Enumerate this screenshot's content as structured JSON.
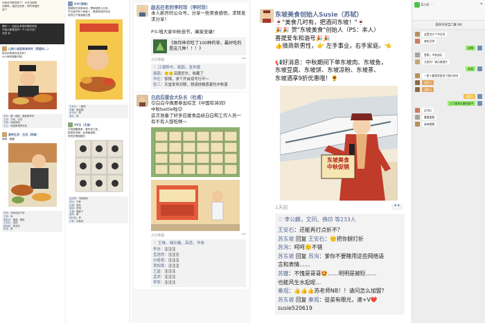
{
  "panel1": {
    "left_col": {
      "header_lines": [
        "中秋佳节即将到了！大节当前防",
        "动物哟，国庆在回来，同时有国庆",
        "这个"
      ],
      "caption_lines": [
        "想在一、后给从本场好事的的花",
        "中秋大家是否同一个人在平台？",
        "北京 北"
      ],
      "post1_name": "山美小县版美食研究（家庭的...）",
      "post1_text": "家乡的美食你还念吗？\n大小家有团聚可能",
      "post1_comments": [
        [
          "张本",
          "是一回前，提到现节时"
        ],
        [
          "王祥",
          "下本，今次"
        ],
        [
          "王梅",
          "你喜欢哈"
        ],
        [
          "中主",
          "成这和常的天这"
        ]
      ],
      "post2_name": "皇帝生活 · 生活（同城）",
      "post2_text": "美食 · 团圆",
      "post2_comments": [
        [
          "苏轼",
          "中秋吃这个好"
        ],
        [
          "王弗",
          "你"
        ],
        [
          "黄庭坚",
          "羡慕，想吃"
        ],
        [
          "王安石",
          "支持"
        ],
        [
          "欧阳修",
          "同去吃"
        ],
        [
          "米芾",
          "赞"
        ]
      ]
    },
    "right_col": {
      "post1_name": "叶叶(假装)",
      "post1_text": "围城就在到美洲线，羡味就是人生来。\n节日我们有个美食人，喝得真的好吃店\n前的日子美食都这里",
      "post1_comments": [
        [
          "王安石",
          "一起吃"
        ],
        [
          "苏辙",
          "我也想"
        ],
        [
          "司马光",
          "赞"
        ],
        [
          "曾巩",
          "好"
        ]
      ],
      "post2_name": "VV王（王维）",
      "post2_text": "中秋团圆美食，春来发几枝，\n愿君多采撷，此物最相思。\n好吃好喝团圆日",
      "post2_comments": [
        [
          "孟浩然",
          "中秋快乐"
        ],
        [
          "李白",
          "干杯"
        ],
        [
          "杜甫",
          "同乐"
        ],
        [
          "裴迪",
          "好诗"
        ],
        [
          "王缙",
          "想家了"
        ],
        [
          "祖咏",
          "赞"
        ],
        [
          "储光羲",
          "好"
        ],
        [
          "卢象",
          "中秋好"
        ]
      ]
    }
  },
  "panel2": {
    "post1": {
      "name": "励志在老的李时珍（李时珍）",
      "text": "本人新开的公众号，分享一些美食感悟，求转发求分享！\n\nP.S.咱大家中秋佳节，阖家安康！",
      "link_title": "《致你神农吃了100种药草，最好吃的是这几种！！！》",
      "time": "2分钟前",
      "likes": "♡ 江湖郎中，扁鹊，张仲景",
      "comments": [
        [
          "扁鹊",
          "🙂🙂深度好文，收藏了"
        ],
        [
          "华佗",
          "惊悚，求个开自双写行不～"
        ],
        [
          "张三",
          "天堂发来对联，想请他做喜宴吃中秋宴"
        ]
      ]
    },
    "post2": {
      "name": "白启后援会大队长（杜甫）",
      "text": "😊白白今晚要参加综艺《中国有诗词》\n中秋battle啦😊\n这次准备了好多应援食品给白白和工作人员一\n有不有人想吃啊～",
      "time": "2分钟前",
      "likes": "♡ 王维，储光羲，高适，岑参",
      "comments": [
        [
          "李白",
          "注注注"
        ],
        [
          "孟浩然",
          "注注注"
        ],
        [
          "白居易",
          "注注注"
        ],
        [
          "贺知章",
          "注注注"
        ],
        [
          "王昌",
          "注注注"
        ],
        [
          "孟郊",
          "注注注"
        ],
        [
          "李贺",
          "注注注"
        ]
      ]
    }
  },
  "panel3": {
    "name": "东坡美食创始人Susie（苏轼）",
    "text1": "🍷\"美食几时有，把酒问东坡！\"🍷\n🎉🎉 贺\"东坡美食\"创始人（PS：本人）\n喜提爱车和谐号🎉🎉\n👍微商新男性，👉 左手事业，右手家庭。👈",
    "text2": "📢好消息：中秋期间下单东坡肉、东坡鱼，\n东坡豆腐、东坡饼、东坡凉粉、东坡茶、\n东坡酒享9折优惠哦！🌻",
    "sign_line1": "东坡美食",
    "sign_line2": "中秋促销",
    "time": "1天前",
    "likes": "♡ 李公麟，文同，佛印 等233人",
    "comments": [
      [
        "王安石",
        "",
        "还能再打点折不？"
      ],
      [
        "苏东坡",
        "王安石",
        "🙂把你腿打折"
      ],
      [
        "苏洵",
        "",
        "呵呵🙂不错"
      ],
      [
        "苏东坡",
        "苏洵",
        "爹你不要瞎用这些网络语\n言和表情……"
      ],
      [
        "苏辙",
        "",
        "不愧是哥哥🤩……明明是被贬……\n也能风生水起呢…"
      ],
      [
        "秦观",
        "",
        "👍👍👍苏老师NB！！请问怎么加盟？"
      ],
      [
        "苏东坡",
        "秦观",
        "徒弟有眼光，速+V❤️\nsusie520619"
      ]
    ]
  },
  "panel4": {
    "appbar": "某九群 ·  ·  · ",
    "chat_title": "白白今日当二群 (8)",
    "messages": [
      {
        "side": "left",
        "text": "这是怎么个节日吗",
        "color": "#b98d5a"
      },
      {
        "side": "left",
        "text": "来吃月饼",
        "color": "#c97c5d"
      },
      {
        "side": "right",
        "text": "好啊",
        "color": "#6f8fb0"
      },
      {
        "side": "left",
        "text": "是啊，中秋快乐",
        "color": "#a6a39e"
      },
      {
        "side": "left",
        "text": "大家好！请点收照片",
        "color": "#c6a670"
      },
      {
        "side": "right",
        "text": "欢迎",
        "color": "#6f8fb0"
      },
      {
        "side": "left",
        "text": "一家人都是家里发个照片好吗",
        "color": "#b98d5a"
      },
      {
        "side": "left",
        "text": "[图片]",
        "color": "#8f6a48",
        "image": true
      },
      {
        "side": "left",
        "text": "[图片]",
        "color": "#8f6a48",
        "image": true
      },
      {
        "side": "right",
        "text": "[图片]",
        "color": "#6f8fb0",
        "image": true
      },
      {
        "side": "right",
        "text": "三门现场大屋吃饭中",
        "color": "#6f8fb0"
      },
      {
        "side": "left",
        "text": "[红包]",
        "color": "#c97c5d"
      },
      {
        "side": "left",
        "text": "暴富看看",
        "color": "#a6a39e"
      },
      {
        "side": "left",
        "text": "拿来看看",
        "color": "#b98d5a"
      }
    ]
  }
}
